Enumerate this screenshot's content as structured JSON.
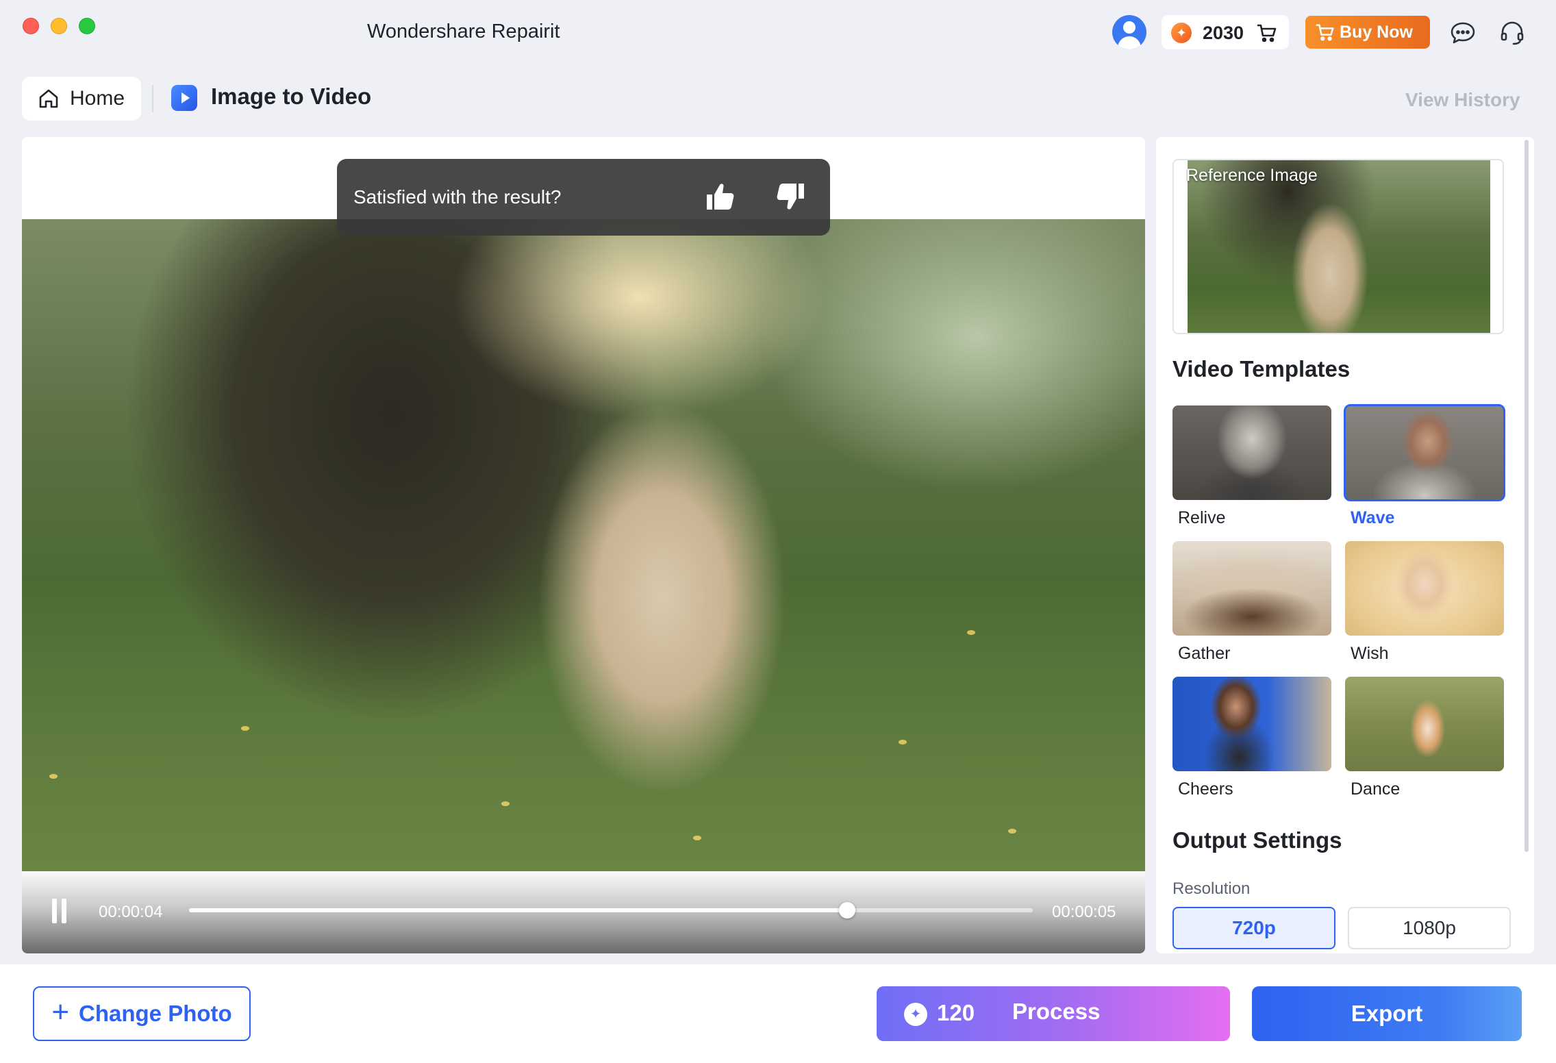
{
  "app": {
    "title": "Wondershare Repairit"
  },
  "topbar": {
    "credits": "2030",
    "buy_now": "Buy Now"
  },
  "header": {
    "home_label": "Home",
    "page_title": "Image to Video",
    "view_history": "View History"
  },
  "preview": {
    "feedback_question": "Satisfied with the result?",
    "current_time": "00:00:04",
    "end_time": "00:00:05",
    "progress_fraction": 0.78
  },
  "sidebar": {
    "reference_label": "Reference Image",
    "templates_title": "Video Templates",
    "templates": [
      {
        "label": "Relive",
        "selected": false
      },
      {
        "label": "Wave",
        "selected": true
      },
      {
        "label": "Gather",
        "selected": false
      },
      {
        "label": "Wish",
        "selected": false
      },
      {
        "label": "Cheers",
        "selected": false
      },
      {
        "label": "Dance",
        "selected": false
      }
    ],
    "output_title": "Output Settings",
    "resolution_label": "Resolution",
    "resolutions": [
      {
        "label": "720p",
        "selected": true
      },
      {
        "label": "1080p",
        "selected": false
      }
    ]
  },
  "bottom": {
    "change_photo": "Change Photo",
    "process_cost": "120",
    "process_label": "Process",
    "export_label": "Export"
  },
  "colors": {
    "accent": "#2e62f0",
    "buy_now": "#f7902a",
    "process_gradient_start": "#6e6ff5",
    "process_gradient_end": "#e46ef0"
  }
}
